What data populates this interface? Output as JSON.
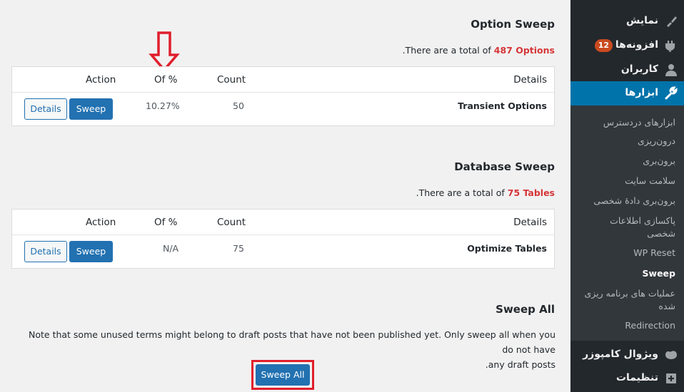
{
  "option_sweep": {
    "title": "Option Sweep",
    "total_prefix": ".There are a total of ",
    "total_value": "487 Options",
    "columns": {
      "details": "Details",
      "count": "Count",
      "percent": "Of %",
      "action": "Action"
    },
    "row": {
      "details": "Transient Options",
      "count": "50",
      "percent": "10.27%",
      "details_btn": "Details",
      "sweep_btn": "Sweep"
    }
  },
  "database_sweep": {
    "title": "Database Sweep",
    "total_prefix": ".There are a total of ",
    "total_value": "75 Tables",
    "columns": {
      "details": "Details",
      "count": "Count",
      "percent": "Of %",
      "action": "Action"
    },
    "row": {
      "details": "Optimize Tables",
      "count": "75",
      "percent": "N/A",
      "details_btn": "Details",
      "sweep_btn": "Sweep"
    }
  },
  "sweep_all": {
    "title": "Sweep All",
    "note_line1": "Note that some unused terms might belong to draft posts that have not been published yet. Only sweep all when you do not have",
    "note_line2": ".any draft posts",
    "button": "Sweep All"
  },
  "sidebar": {
    "menu": [
      {
        "label": "نمایش",
        "icon": "paintbrush-icon"
      },
      {
        "label": "افزونه‌ها",
        "icon": "plugin-icon",
        "badge": "12"
      },
      {
        "label": "کاربران",
        "icon": "users-icon"
      },
      {
        "label": "ابزارها",
        "icon": "wrench-icon",
        "active": true
      },
      {
        "label": "ویژوال کامپوزر",
        "icon": "composer-icon"
      },
      {
        "label": "تنظیمات",
        "icon": "settings-icon"
      }
    ],
    "submenu": [
      "ابزارهای دردسترس",
      "درون‌ریزی",
      "برون‌بری",
      "سلامت سایت",
      "برون‌بری دادهٔ شخصی",
      "پاکسازی اطلاعات شخصی",
      "WP Reset",
      "Sweep",
      "عملیات های برنامه ریزی شده",
      "Redirection"
    ],
    "current_submenu": "Sweep"
  },
  "colors": {
    "accent": "#2271b1",
    "active_menu": "#0073aa",
    "highlight_red": "#d63638",
    "annotation_red": "#e01e2c",
    "sidebar_bg": "#23282d"
  }
}
